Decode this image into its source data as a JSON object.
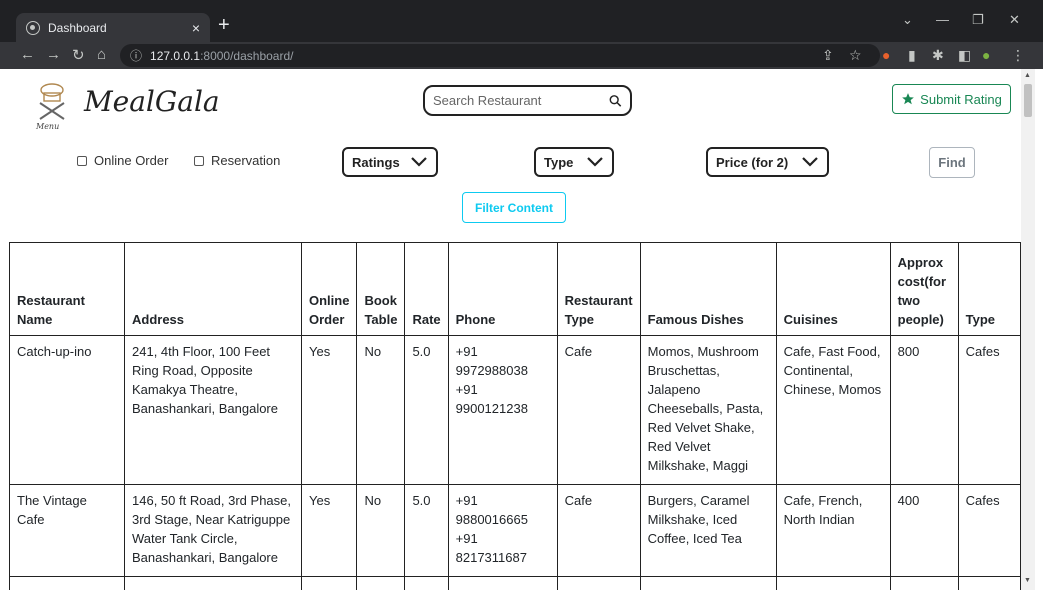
{
  "browser": {
    "tab_title": "Dashboard",
    "tab_close": "×",
    "new_tab": "+",
    "url_host": "127.0.0.1",
    "url_rest": ":8000/dashboard/"
  },
  "header": {
    "brand": "MealGala",
    "search_placeholder": "Search Restaurant",
    "submit_rating": "Submit Rating"
  },
  "filters": {
    "online_order": "Online Order",
    "reservation": "Reservation",
    "ratings": "Ratings",
    "type": "Type",
    "price": "Price (for 2)",
    "find": "Find",
    "filter_content": "Filter Content"
  },
  "table": {
    "headers": [
      "Restaurant Name",
      "Address",
      "Online Order",
      "Book Table",
      "Rate",
      "Phone",
      "Restaurant Type",
      "Famous Dishes",
      "Cuisines",
      "Approx cost(for two people)",
      "Type"
    ],
    "rows": [
      {
        "name": "Catch-up-ino",
        "address": "241, 4th Floor, 100 Feet Ring Road, Opposite Kamakya Theatre, Banashankari, Bangalore",
        "online_order": "Yes",
        "book_table": "No",
        "rate": "5.0",
        "phone": "+91 9972988038 +91 9900121238",
        "restaurant_type": "Cafe",
        "famous_dishes": "Momos, Mushroom Bruschettas, Jalapeno Cheeseballs, Pasta, Red Velvet Shake, Red Velvet Milkshake, Maggi",
        "cuisines": "Cafe, Fast Food, Continental, Chinese, Momos",
        "cost": "800",
        "type": "Cafes"
      },
      {
        "name": "The Vintage Cafe",
        "address": "146, 50 ft Road, 3rd Phase, 3rd Stage, Near Katriguppe Water Tank Circle, Banashankari, Bangalore",
        "online_order": "Yes",
        "book_table": "No",
        "rate": "5.0",
        "phone": "+91 9880016665 +91 8217311687",
        "restaurant_type": "Cafe",
        "famous_dishes": "Burgers, Caramel Milkshake, Iced Coffee, Iced Tea",
        "cuisines": "Cafe, French, North Indian",
        "cost": "400",
        "type": "Cafes"
      }
    ]
  }
}
